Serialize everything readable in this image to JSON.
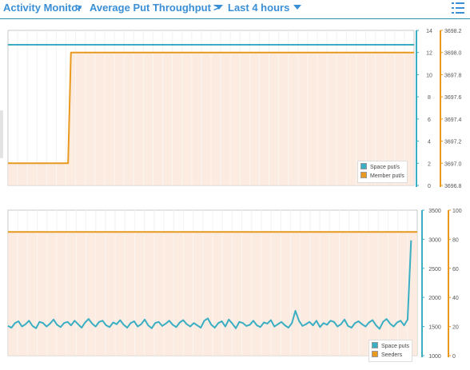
{
  "breadcrumb": {
    "root": "Activity Monitor",
    "metric": "Average Put Throughput",
    "range": "Last 4 hours"
  },
  "icons": {
    "separator": "chevron-right-icon",
    "dropdown": "caret-down-icon",
    "menu": "list-menu-icon"
  },
  "colors": {
    "accent": "#3a8fd6",
    "teal": "#3aaec2",
    "orange": "#e99a1e",
    "fill_orange": "#fae8dc"
  },
  "chart_data": [
    {
      "type": "line",
      "y_left_ticks": [
        "0",
        "2",
        "4",
        "6",
        "8",
        "10",
        "12",
        "14"
      ],
      "y_right_ticks": [
        "3696.8",
        "3697.0",
        "3697.2",
        "3697.4",
        "3697.6",
        "3697.8",
        "3698.0",
        "3698.2"
      ],
      "ylim_left": [
        0,
        14
      ],
      "ylim_right": [
        3696.8,
        3698.2
      ],
      "grid": true,
      "legend_position": "bottom-right",
      "series": [
        {
          "name": "Space put/s",
          "axis": "left",
          "color": "#3aaec2",
          "x": [
            0,
            100
          ],
          "values": [
            12.7,
            12.7
          ]
        },
        {
          "name": "Member put/s",
          "axis": "left",
          "color": "#e99a1e",
          "fill": true,
          "x": [
            0,
            14.8,
            15.5,
            100
          ],
          "values": [
            2,
            2,
            12,
            12
          ]
        }
      ]
    },
    {
      "type": "line",
      "y_left_ticks": [
        "1000",
        "1500",
        "2000",
        "2500",
        "3000",
        "3500"
      ],
      "y_right_ticks": [
        "0",
        "20",
        "40",
        "60",
        "80",
        "100"
      ],
      "ylim_left": [
        1000,
        3500
      ],
      "ylim_right": [
        0,
        100
      ],
      "grid": true,
      "legend_position": "bottom-right",
      "series": [
        {
          "name": "Space puts",
          "axis": "left",
          "color": "#3aaec2",
          "values": [
            1510,
            1480,
            1560,
            1590,
            1500,
            1540,
            1600,
            1510,
            1470,
            1580,
            1560,
            1500,
            1550,
            1620,
            1530,
            1490,
            1560,
            1580,
            1520,
            1600,
            1540,
            1480,
            1570,
            1630,
            1550,
            1500,
            1580,
            1600,
            1520,
            1490,
            1570,
            1540,
            1610,
            1530,
            1480,
            1560,
            1590,
            1500,
            1540,
            1620,
            1520,
            1470,
            1560,
            1580,
            1510,
            1550,
            1600,
            1530,
            1490,
            1570,
            1610,
            1540,
            1500,
            1560,
            1520,
            1480,
            1600,
            1640,
            1530,
            1480,
            1560,
            1590,
            1500,
            1620,
            1550,
            1470,
            1580,
            1560,
            1510,
            1530,
            1600,
            1520,
            1490,
            1570,
            1550,
            1610,
            1500,
            1540,
            1580,
            1520,
            1480,
            1560,
            1770,
            1600,
            1510,
            1540,
            1580,
            1520,
            1600,
            1490,
            1560,
            1530,
            1600,
            1580,
            1500,
            1540,
            1620,
            1510,
            1480,
            1560,
            1590,
            1540,
            1500,
            1570,
            1610,
            1520,
            1460,
            1580,
            1630,
            1550,
            1500,
            1570,
            1600,
            1520,
            1620,
            2980
          ]
        },
        {
          "name": "Seeders",
          "axis": "right",
          "color": "#e99a1e",
          "fill": true,
          "x": [
            0,
            100
          ],
          "values": [
            85,
            85
          ]
        }
      ]
    }
  ]
}
